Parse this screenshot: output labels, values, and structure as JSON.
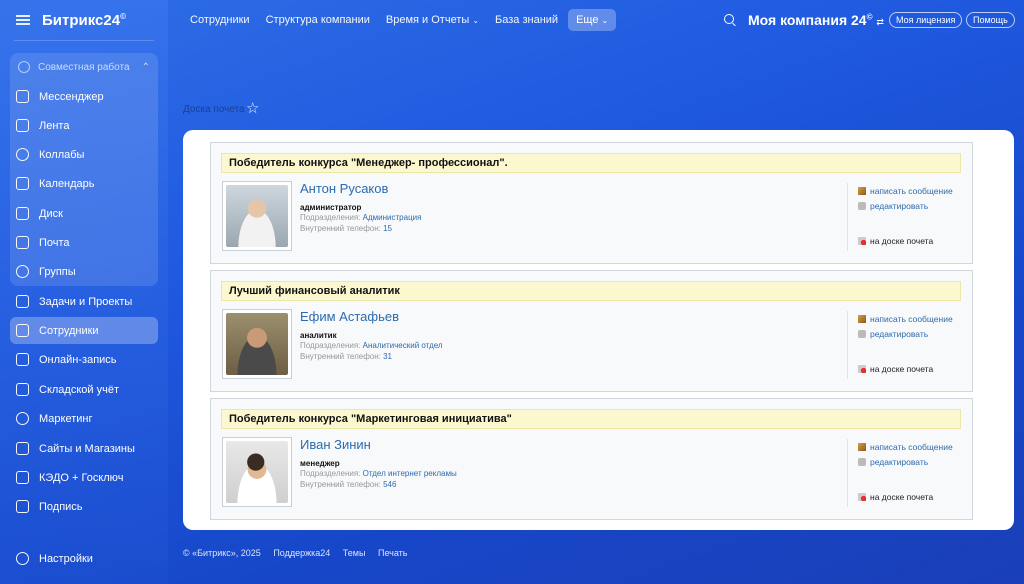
{
  "app": {
    "logo": "Битрикс24",
    "logo_mark": "©"
  },
  "sidebar": {
    "group_label": "Совместная работа",
    "items": [
      {
        "label": "Мессенджер"
      },
      {
        "label": "Лента"
      },
      {
        "label": "Коллабы"
      },
      {
        "label": "Календарь"
      },
      {
        "label": "Диск"
      },
      {
        "label": "Почта"
      },
      {
        "label": "Группы"
      },
      {
        "label": "Задачи и Проекты"
      },
      {
        "label": "Сотрудники"
      },
      {
        "label": "Онлайн-запись"
      },
      {
        "label": "Складской учёт"
      },
      {
        "label": "Маркетинг"
      },
      {
        "label": "Сайты и Магазины"
      },
      {
        "label": "КЭДО + Госключ"
      },
      {
        "label": "Подпись"
      }
    ],
    "settings_label": "Настройки"
  },
  "topnav": {
    "links": [
      "Сотрудники",
      "Структура компании",
      "Время и Отчеты",
      "База знаний"
    ],
    "more": "Еще",
    "company": "Моя компания 24",
    "license": "Моя лицензия",
    "help": "Помощь"
  },
  "page": {
    "title": "Доска почета"
  },
  "entries": [
    {
      "title": "Победитель конкурса \"Менеджер- профессионал\".",
      "name": "Антон Русаков",
      "role": "администратор",
      "dept_label": "Подразделения:",
      "dept": "Администрация",
      "phone_label": "Внутренний телефон:",
      "phone": "15"
    },
    {
      "title": "Лучший финансовый аналитик",
      "name": "Ефим Астафьев",
      "role": "аналитик",
      "dept_label": "Подразделения:",
      "dept": "Аналитический отдел",
      "phone_label": "Внутренний телефон:",
      "phone": "31"
    },
    {
      "title": "Победитель конкурса \"Маркетинговая инициатива\"",
      "name": "Иван Зинин",
      "role": "менеджер",
      "dept_label": "Подразделения:",
      "dept": "Отдел интернет рекламы",
      "phone_label": "Внутренний телефон:",
      "phone": "546"
    }
  ],
  "actions": {
    "message": "написать сообщение",
    "edit": "редактировать",
    "board": "на доске почета"
  },
  "footer": {
    "copyright": "© «Битрикс», 2025",
    "support": "Поддержка24",
    "themes": "Темы",
    "print": "Печать"
  },
  "colors": {
    "accent": "#2d6bb0",
    "highlight": "#fbf8cf"
  }
}
